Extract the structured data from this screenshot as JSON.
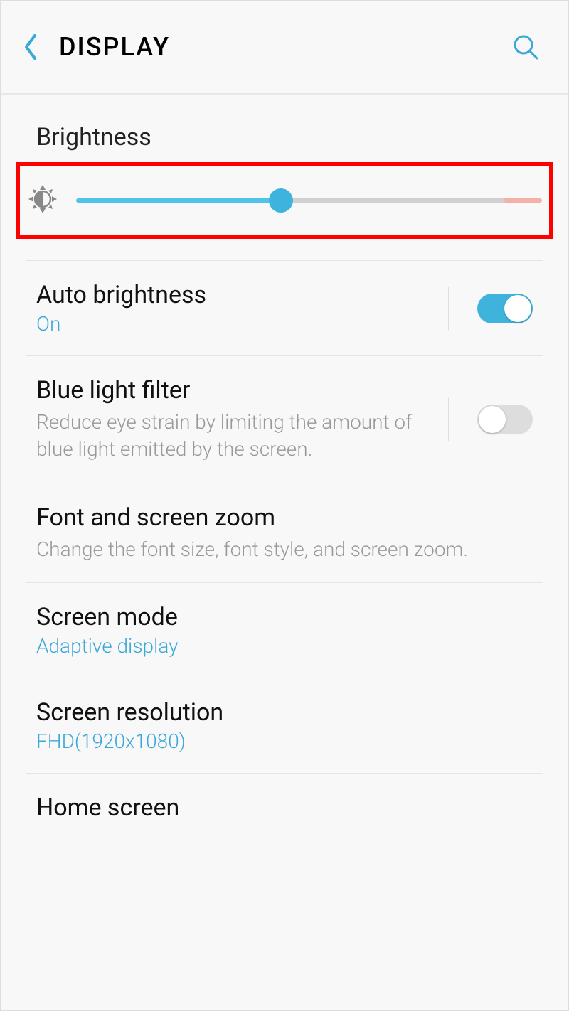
{
  "header": {
    "title": "DISPLAY"
  },
  "brightness": {
    "section_label": "Brightness",
    "value_percent": 44
  },
  "auto_brightness": {
    "title": "Auto brightness",
    "status": "On",
    "enabled": true
  },
  "blue_light": {
    "title": "Blue light filter",
    "description": "Reduce eye strain by limiting the amount of blue light emitted by the screen.",
    "enabled": false
  },
  "font_zoom": {
    "title": "Font and screen zoom",
    "description": "Change the font size, font style, and screen zoom."
  },
  "screen_mode": {
    "title": "Screen mode",
    "value": "Adaptive display"
  },
  "screen_resolution": {
    "title": "Screen resolution",
    "value": "FHD(1920x1080)"
  },
  "home_screen": {
    "title": "Home screen"
  },
  "colors": {
    "accent": "#3ba8d8",
    "slider_fill": "#4fc3e8",
    "highlight_border": "#ff0000"
  }
}
